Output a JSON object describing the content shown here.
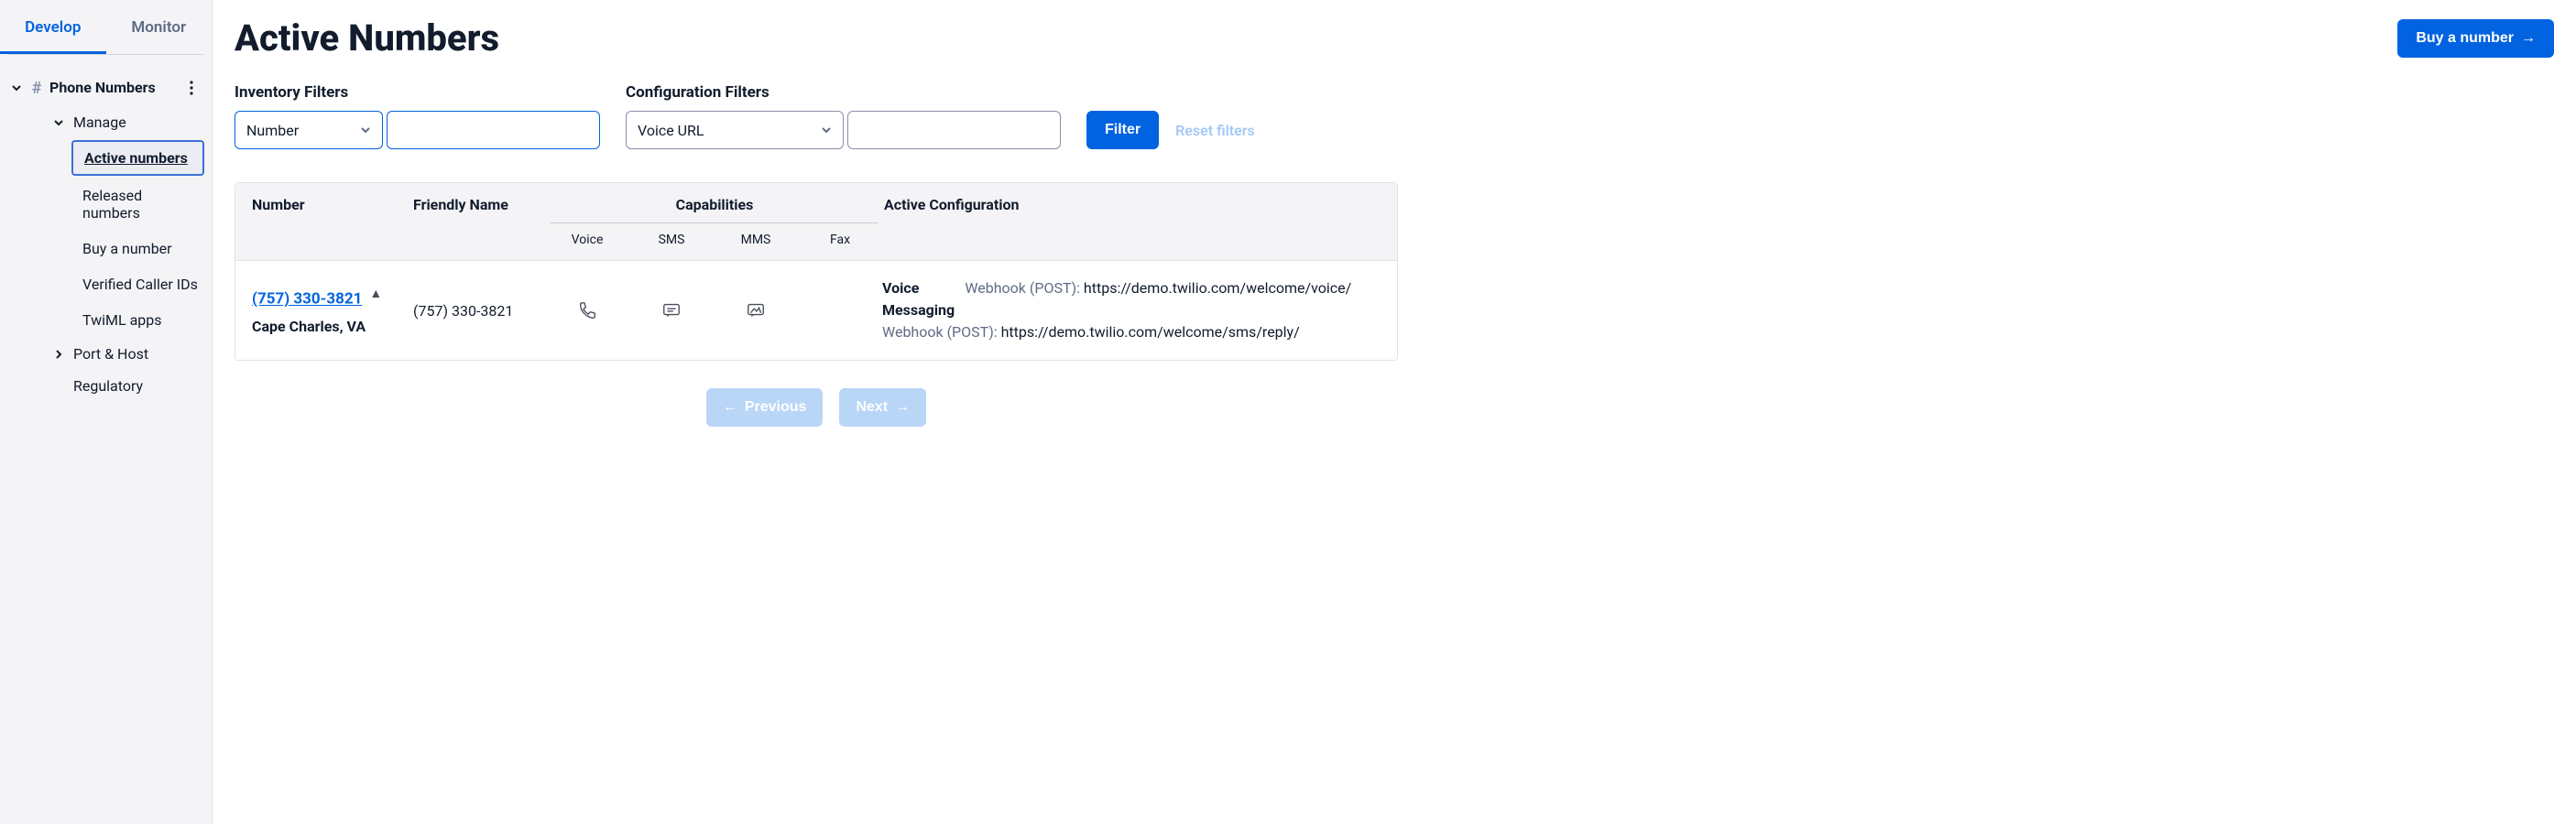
{
  "sidebar": {
    "tabs": {
      "develop": "Develop",
      "monitor": "Monitor"
    },
    "section_label": "Phone Numbers",
    "manage_label": "Manage",
    "leaves": {
      "active": "Active numbers",
      "released": "Released numbers",
      "buy": "Buy a number",
      "verified": "Verified Caller IDs",
      "twiml": "TwiML apps"
    },
    "port_host": "Port & Host",
    "regulatory": "Regulatory"
  },
  "header": {
    "title": "Active Numbers",
    "buy_button": "Buy a number"
  },
  "filters": {
    "inventory_label": "Inventory Filters",
    "inventory_select": "Number",
    "config_label": "Configuration Filters",
    "config_select": "Voice URL",
    "filter_button": "Filter",
    "reset": "Reset filters"
  },
  "table": {
    "headers": {
      "number": "Number",
      "friendly": "Friendly Name",
      "capabilities": "Capabilities",
      "active_config": "Active Configuration",
      "voice": "Voice",
      "sms": "SMS",
      "mms": "MMS",
      "fax": "Fax"
    },
    "rows": [
      {
        "number": "(757) 330-3821",
        "location": "Cape Charles, VA",
        "friendly": "(757) 330-3821",
        "config": {
          "voice_kind": "Voice",
          "voice_proto": "Webhook (POST):",
          "voice_url": "https://demo.twilio.com/welcome/voice/",
          "msg_kind": "Messaging",
          "msg_proto": "Webhook (POST):",
          "msg_url": "https://demo.twilio.com/welcome/sms/reply/"
        }
      }
    ]
  },
  "pager": {
    "prev": "Previous",
    "next": "Next"
  }
}
